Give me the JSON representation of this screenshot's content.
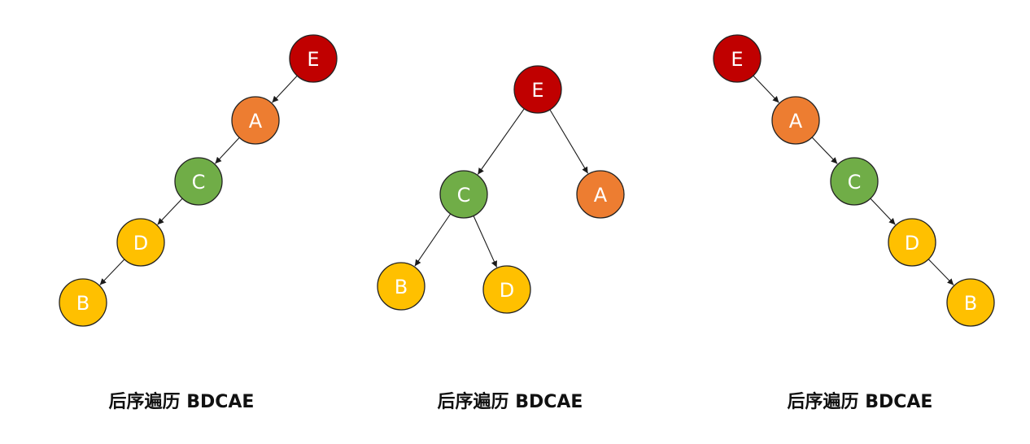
{
  "colors": {
    "E": "#C00000",
    "A": "#ED7D31",
    "C": "#70AD47",
    "D": "#FFC000",
    "B": "#FFC000",
    "edge": "#1a1a1a",
    "node_text": "#ffffff"
  },
  "trees": [
    {
      "id": "left-skewed",
      "caption": "后序遍历 BDCAE",
      "nodes": [
        {
          "id": "E",
          "label": "E"
        },
        {
          "id": "A",
          "label": "A"
        },
        {
          "id": "C",
          "label": "C"
        },
        {
          "id": "D",
          "label": "D"
        },
        {
          "id": "B",
          "label": "B"
        }
      ],
      "edges": [
        {
          "from": "E",
          "to": "A"
        },
        {
          "from": "A",
          "to": "C"
        },
        {
          "from": "C",
          "to": "D"
        },
        {
          "from": "D",
          "to": "B"
        }
      ]
    },
    {
      "id": "balanced",
      "caption": "后序遍历 BDCAE",
      "nodes": [
        {
          "id": "E",
          "label": "E"
        },
        {
          "id": "C",
          "label": "C"
        },
        {
          "id": "A",
          "label": "A"
        },
        {
          "id": "B",
          "label": "B"
        },
        {
          "id": "D",
          "label": "D"
        }
      ],
      "edges": [
        {
          "from": "E",
          "to": "C"
        },
        {
          "from": "E",
          "to": "A"
        },
        {
          "from": "C",
          "to": "B"
        },
        {
          "from": "C",
          "to": "D"
        }
      ]
    },
    {
      "id": "right-skewed",
      "caption": "后序遍历 BDCAE",
      "nodes": [
        {
          "id": "E",
          "label": "E"
        },
        {
          "id": "A",
          "label": "A"
        },
        {
          "id": "C",
          "label": "C"
        },
        {
          "id": "D",
          "label": "D"
        },
        {
          "id": "B",
          "label": "B"
        }
      ],
      "edges": [
        {
          "from": "E",
          "to": "A"
        },
        {
          "from": "A",
          "to": "C"
        },
        {
          "from": "C",
          "to": "D"
        },
        {
          "from": "D",
          "to": "B"
        }
      ]
    }
  ]
}
